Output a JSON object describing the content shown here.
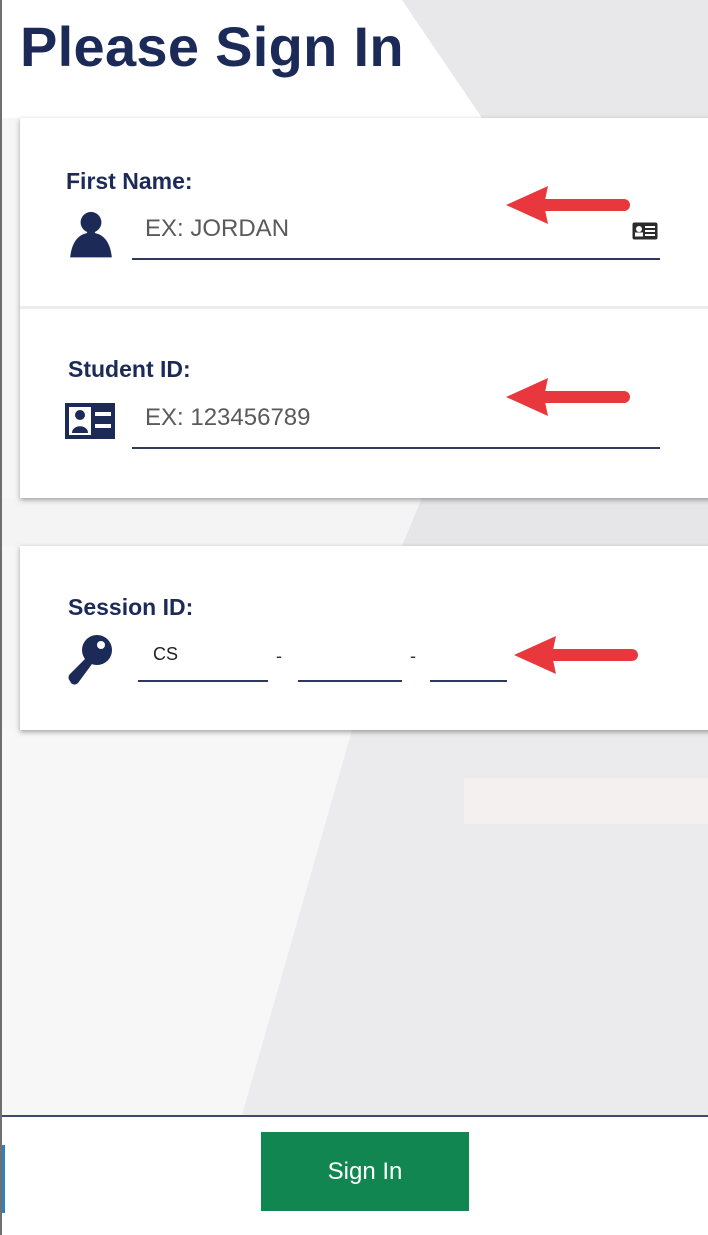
{
  "page": {
    "title": "Please Sign In"
  },
  "first_name": {
    "label": "First Name:",
    "placeholder": "EX: JORDAN",
    "icon": "person-icon",
    "trailing_icon": "id-card-icon"
  },
  "student_id": {
    "label": "Student ID:",
    "placeholder": "EX: 123456789",
    "icon": "id-card-icon"
  },
  "session_id": {
    "label": "Session ID:",
    "icon": "key-icon",
    "segments": [
      "CS",
      "",
      ""
    ],
    "separator": "-"
  },
  "footer": {
    "signin_label": "Sign In"
  },
  "colors": {
    "title": "#1c2a58",
    "signin_button": "#128651",
    "arrow": "#e8383d"
  }
}
